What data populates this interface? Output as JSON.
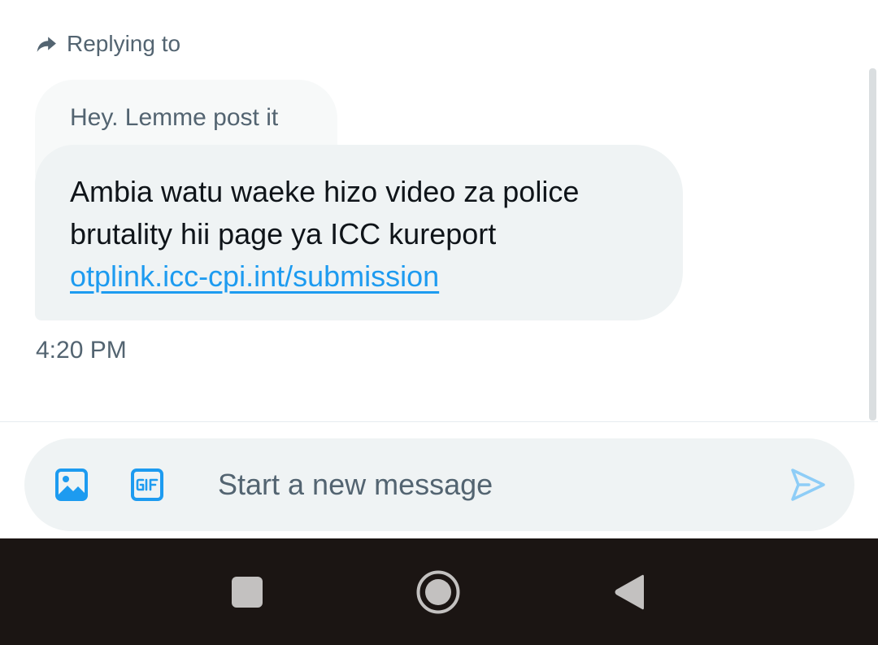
{
  "reply": {
    "label": "Replying to",
    "quoted_text": "Hey. Lemme post it"
  },
  "message": {
    "line1": "Ambia watu waeke hizo video za police",
    "line2": "brutality hii page ya ICC kureport",
    "link_text": "otplink.icc-cpi.int/submission",
    "timestamp": "4:20 PM"
  },
  "composer": {
    "placeholder": "Start a new message",
    "value": "",
    "media_icon": "image-icon",
    "gif_icon": "gif-icon",
    "send_icon": "send-icon"
  },
  "navbar": {
    "recents_icon": "square-icon",
    "home_icon": "circle-icon",
    "back_icon": "triangle-back-icon"
  },
  "colors": {
    "accent": "#1d9bf0",
    "accent_disabled": "#8ecdf7",
    "text_primary": "#0f1419",
    "text_secondary": "#536471",
    "bubble": "#eff3f4",
    "nav_background": "#1b1513"
  }
}
